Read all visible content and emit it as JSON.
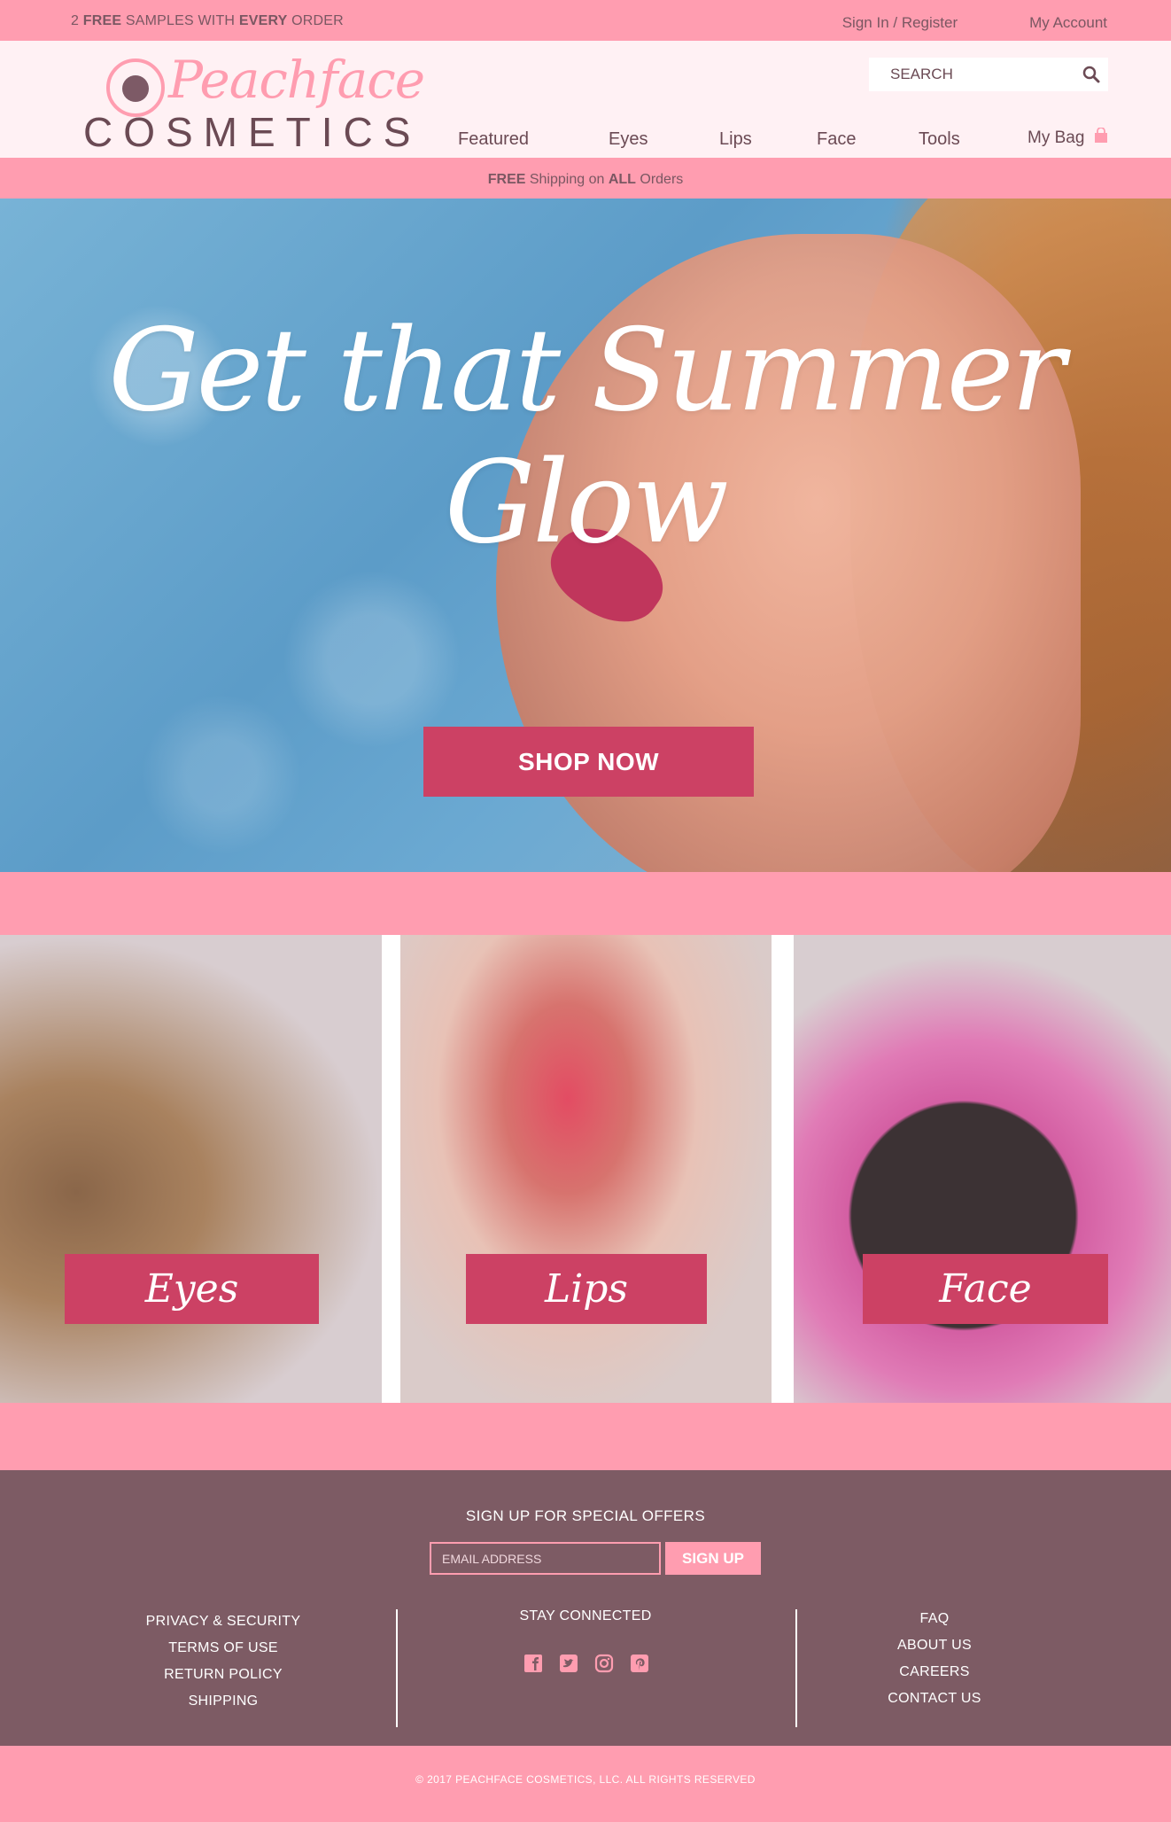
{
  "topbar": {
    "promo_prefix": "2 ",
    "promo_free": "FREE",
    "promo_middle": " SAMPLES WITH ",
    "promo_every": "EVERY",
    "promo_suffix": " ORDER",
    "sign_in": "Sign In / Register",
    "account": "My Account"
  },
  "header": {
    "logo_script": "Peachface",
    "logo_word": "COSMETICS",
    "search_placeholder": "SEARCH",
    "nav": [
      "Featured",
      "Eyes",
      "Lips",
      "Face",
      "Tools"
    ],
    "bag": "My Bag"
  },
  "shipping": {
    "free": "FREE",
    "middle": " Shipping on ",
    "all": "ALL",
    "suffix": " Orders"
  },
  "hero": {
    "title": "Get that Summer Glow",
    "cta": "SHOP NOW"
  },
  "categories": [
    "Eyes",
    "Lips",
    "Face"
  ],
  "footer": {
    "signup_title": "SIGN UP FOR SPECIAL OFFERS",
    "email_placeholder": "EMAIL ADDRESS",
    "signup_button": "SIGN UP",
    "left_links": [
      "PRIVACY & SECURITY",
      "TERMS OF USE",
      "RETURN POLICY",
      "SHIPPING"
    ],
    "stay_connected": "STAY CONNECTED",
    "right_links": [
      "FAQ",
      "ABOUT US",
      "CAREERS",
      "CONTACT US"
    ],
    "copyright": "© 2017 PEACHFACE COSMETICS, LLC. ALL RIGHTS RESERVED"
  },
  "colors": {
    "pink": "#ff9db0",
    "rose": "#cc4164",
    "plum": "#7d5b64",
    "header_bg": "#fff1f4"
  }
}
